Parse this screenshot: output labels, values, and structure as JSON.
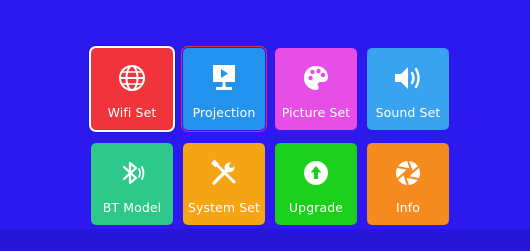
{
  "menu": {
    "tiles": [
      {
        "label": "Wifi Set",
        "icon": "globe-icon",
        "color": "#f0343c"
      },
      {
        "label": "Projection",
        "icon": "projector-screen-icon",
        "color": "#2493f0"
      },
      {
        "label": "Picture Set",
        "icon": "palette-icon",
        "color": "#e64ee6"
      },
      {
        "label": "Sound Set",
        "icon": "speaker-icon",
        "color": "#3aa3f0"
      },
      {
        "label": "BT Model",
        "icon": "bluetooth-icon",
        "color": "#2ec98a"
      },
      {
        "label": "System Set",
        "icon": "tools-icon",
        "color": "#f5a414"
      },
      {
        "label": "Upgrade",
        "icon": "upload-icon",
        "color": "#1ad01a"
      },
      {
        "label": "Info",
        "icon": "aperture-icon",
        "color": "#f58a1e"
      }
    ]
  },
  "state": {
    "selected": "Wifi Set",
    "focused": "Projection"
  },
  "colors": {
    "background": "#2b19ee",
    "tile_text": "#ffffff",
    "focus_border": "#e0305c"
  }
}
